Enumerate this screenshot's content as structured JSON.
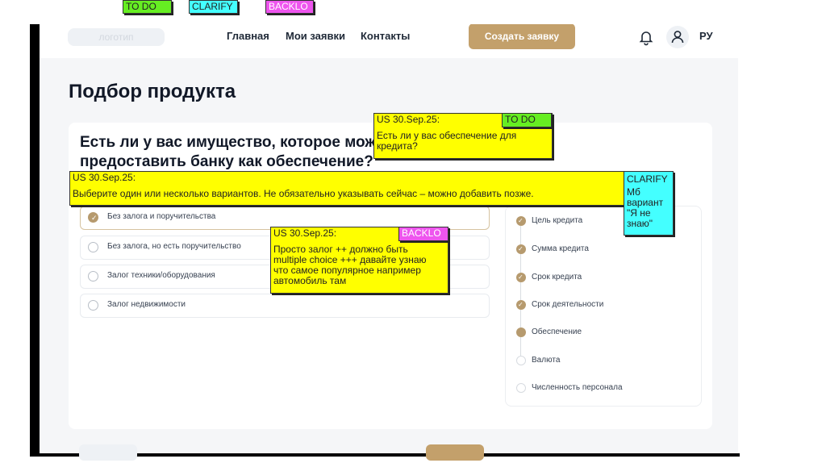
{
  "top_tags": [
    {
      "label": "TO DO",
      "color": "#66ee22"
    },
    {
      "label": "CLARIFY",
      "color": "#44ffff"
    },
    {
      "label": "BACKLO\nG",
      "color": "#ee55ee"
    }
  ],
  "header": {
    "logo": "логотип",
    "nav": [
      "Главная",
      "Мои заявки",
      "Контакты"
    ],
    "cta": "Создать заявку",
    "lang": "РУ"
  },
  "page": {
    "title": "Подбор продукта",
    "question": "Есть ли у вас имущество, которое можете предоставить банку как обеспечение?"
  },
  "options": [
    {
      "label": "Без залога и поручительства",
      "selected": true
    },
    {
      "label": "Без залога, но есть поручительство",
      "selected": false
    },
    {
      "label": "Залог техники/оборудования",
      "selected": false
    },
    {
      "label": "Залог недвижимости",
      "selected": false
    }
  ],
  "steps": [
    {
      "label": "Цель кредита",
      "state": "done"
    },
    {
      "label": "Сумма кредита",
      "state": "done"
    },
    {
      "label": "Срок кредита",
      "state": "done"
    },
    {
      "label": "Срок деятельности",
      "state": "done"
    },
    {
      "label": "Обеспечение",
      "state": "current"
    },
    {
      "label": "Валюта",
      "state": "todo"
    },
    {
      "label": "Численность персонала",
      "state": "todo"
    }
  ],
  "notes": {
    "note1": {
      "header": "US 30.Sep.25:",
      "text": "Есть ли у вас обеспечение для кредита?",
      "tag": "TO DO"
    },
    "note2": {
      "header": "US 30.Sep.25:",
      "text": "Выберите один или несколько вариантов. Не обязательно указывать сейчас – можно добавить позже.",
      "tag": "CLARIFY",
      "tag_text": "Мб вариант \"Я не знаю\""
    },
    "note3": {
      "header": "US 30.Sep.25:",
      "text": "Просто залог ++ должно быть multiple choice +++ давайте узнаю что самое популярное например автомобиль там",
      "tag": "BACKLO\nG"
    }
  }
}
